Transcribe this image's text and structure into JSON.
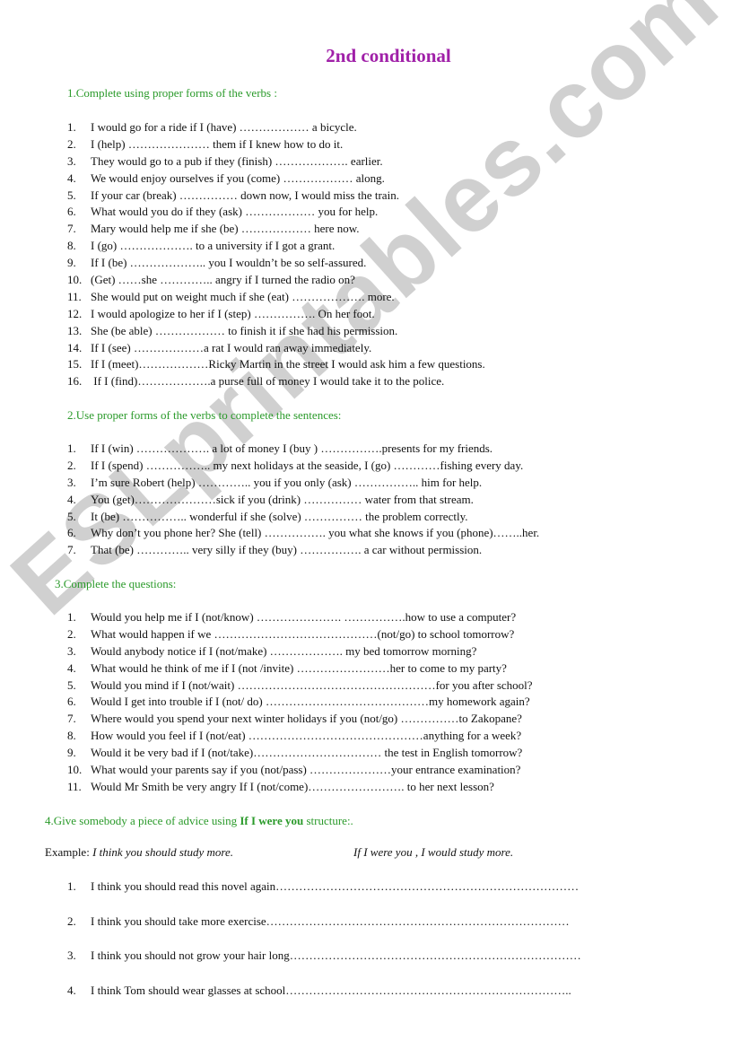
{
  "watermark": "ESLprintables.com",
  "title": "2nd conditional",
  "colors": {
    "title": "#a020a8",
    "section": "#2a9a2a",
    "watermark": "#969696"
  },
  "section1": {
    "heading": "1.Complete using proper forms of the verbs :",
    "items": [
      {
        "n": "1.",
        "text": "I would go for a ride if I (have) ……………… a bicycle."
      },
      {
        "n": "2.",
        "text": "I (help) ………………… them if I knew how to do it."
      },
      {
        "n": "3.",
        "text": "They would go to a pub if they (finish) ………………. earlier."
      },
      {
        "n": "4.",
        "text": "We would enjoy ourselves if you (come) ……………… along."
      },
      {
        "n": "5.",
        "text": "If your car (break) …………… down now, I would miss the train."
      },
      {
        "n": "6.",
        "text": "What would you do if they (ask) ……………… you for help."
      },
      {
        "n": "7.",
        "text": "Mary would help me if she (be) ……………… here now."
      },
      {
        "n": "8.",
        "text": "I (go) ………………. to a university if I got a grant."
      },
      {
        "n": "9.",
        "text": "If I (be) ……………….. you I wouldn’t be so self-assured."
      },
      {
        "n": "10.",
        "text": "(Get) ……she ………….. angry if I turned the radio on?"
      },
      {
        "n": "11.",
        "text": "She would put on weight much if she (eat) ………………. more."
      },
      {
        "n": "12.",
        "text": "I would apologize to her if I (step) ……………. On her foot."
      },
      {
        "n": "13.",
        "text": "She (be able) ……………… to finish it if she had his permission."
      },
      {
        "n": "14.",
        "text": "If I (see) ………………a rat I would ran away immediately."
      },
      {
        "n": "15.",
        "text": "If I (meet)………………Ricky Martin in the street I would ask him a few questions."
      },
      {
        "n": "16.",
        "text": " If I (find)……………….a purse full of money I would take it to the police."
      }
    ]
  },
  "section2": {
    "heading": "2.Use proper forms of the verbs to complete the sentences:",
    "items": [
      {
        "n": "1.",
        "text": "If I (win) ………………. a lot of money I (buy ) …………….presents for my friends."
      },
      {
        "n": "2.",
        "text": "If I (spend) …………….. my next holidays at the seaside, I (go) …………fishing every day."
      },
      {
        "n": "3.",
        "text": "I’m sure Robert (help) ………….. you if you only (ask) …………….. him for help."
      },
      {
        "n": "4.",
        "text": "You (get)…………………sick if you (drink) …………… water from that stream."
      },
      {
        "n": "5.",
        "text": "It (be) …………….. wonderful if she (solve) …………… the problem correctly."
      },
      {
        "n": "6.",
        "text": "Why don’t you phone her? She (tell) ……………. you what she knows if you (phone)……..her."
      },
      {
        "n": "7.",
        "text": "That (be) ………….. very silly if they (buy) ……………. a car without permission."
      }
    ]
  },
  "section3": {
    "heading": "3.Complete the questions:",
    "items": [
      {
        "n": "1.",
        "text": "Would you help me if I (not/know) …………………. …………….how to use a computer?"
      },
      {
        "n": "2.",
        "text": "What would happen if we ……………………………………(not/go) to school tomorrow?"
      },
      {
        "n": "3.",
        "text": "Would anybody notice if I (not/make) ………………. my bed tomorrow morning?"
      },
      {
        "n": "4.",
        "text": "What would he think of me if I (not /invite) ……………………her to come to my party?"
      },
      {
        "n": "5.",
        "text": "Would you mind if I (not/wait) ……………………………………………for you after school?"
      },
      {
        "n": "6.",
        "text": "Would I get into trouble if I (not/ do) ……………………………………my homework again?"
      },
      {
        "n": "7.",
        "text": "Where would you spend your next winter holidays if you (not/go) ……………to Zakopane?"
      },
      {
        "n": "8.",
        "text": "How would you feel if I (not/eat) ………………………………………anything for a week?"
      },
      {
        "n": "9.",
        "text": "Would it be very bad if I (not/take)…………………………… the test in English tomorrow?"
      },
      {
        "n": "10.",
        "text": "What would your parents say if you (not/pass) …………………your entrance examination?"
      },
      {
        "n": "11.",
        "text": "Would Mr Smith be very angry If I (not/come)……………………. to her next lesson?"
      }
    ]
  },
  "section4": {
    "heading_pre": "4.Give somebody a piece of advice using ",
    "heading_bold": "If I were you",
    "heading_post": " structure:.",
    "example_label": "Example: ",
    "example_sentence": "I think you should study more.",
    "example_answer": "If I were you ,  I would study more.",
    "items": [
      {
        "n": "1.",
        "text": "I think you should read this novel again……………………………………………………………………"
      },
      {
        "n": "2.",
        "text": "I think you should take more exercise……………………………………………………………………"
      },
      {
        "n": "3.",
        "text": "I think you should not grow your hair long…………………………………………………………………"
      },
      {
        "n": "4.",
        "text": "I think Tom should wear glasses at school……………………………………………………………….."
      }
    ]
  }
}
